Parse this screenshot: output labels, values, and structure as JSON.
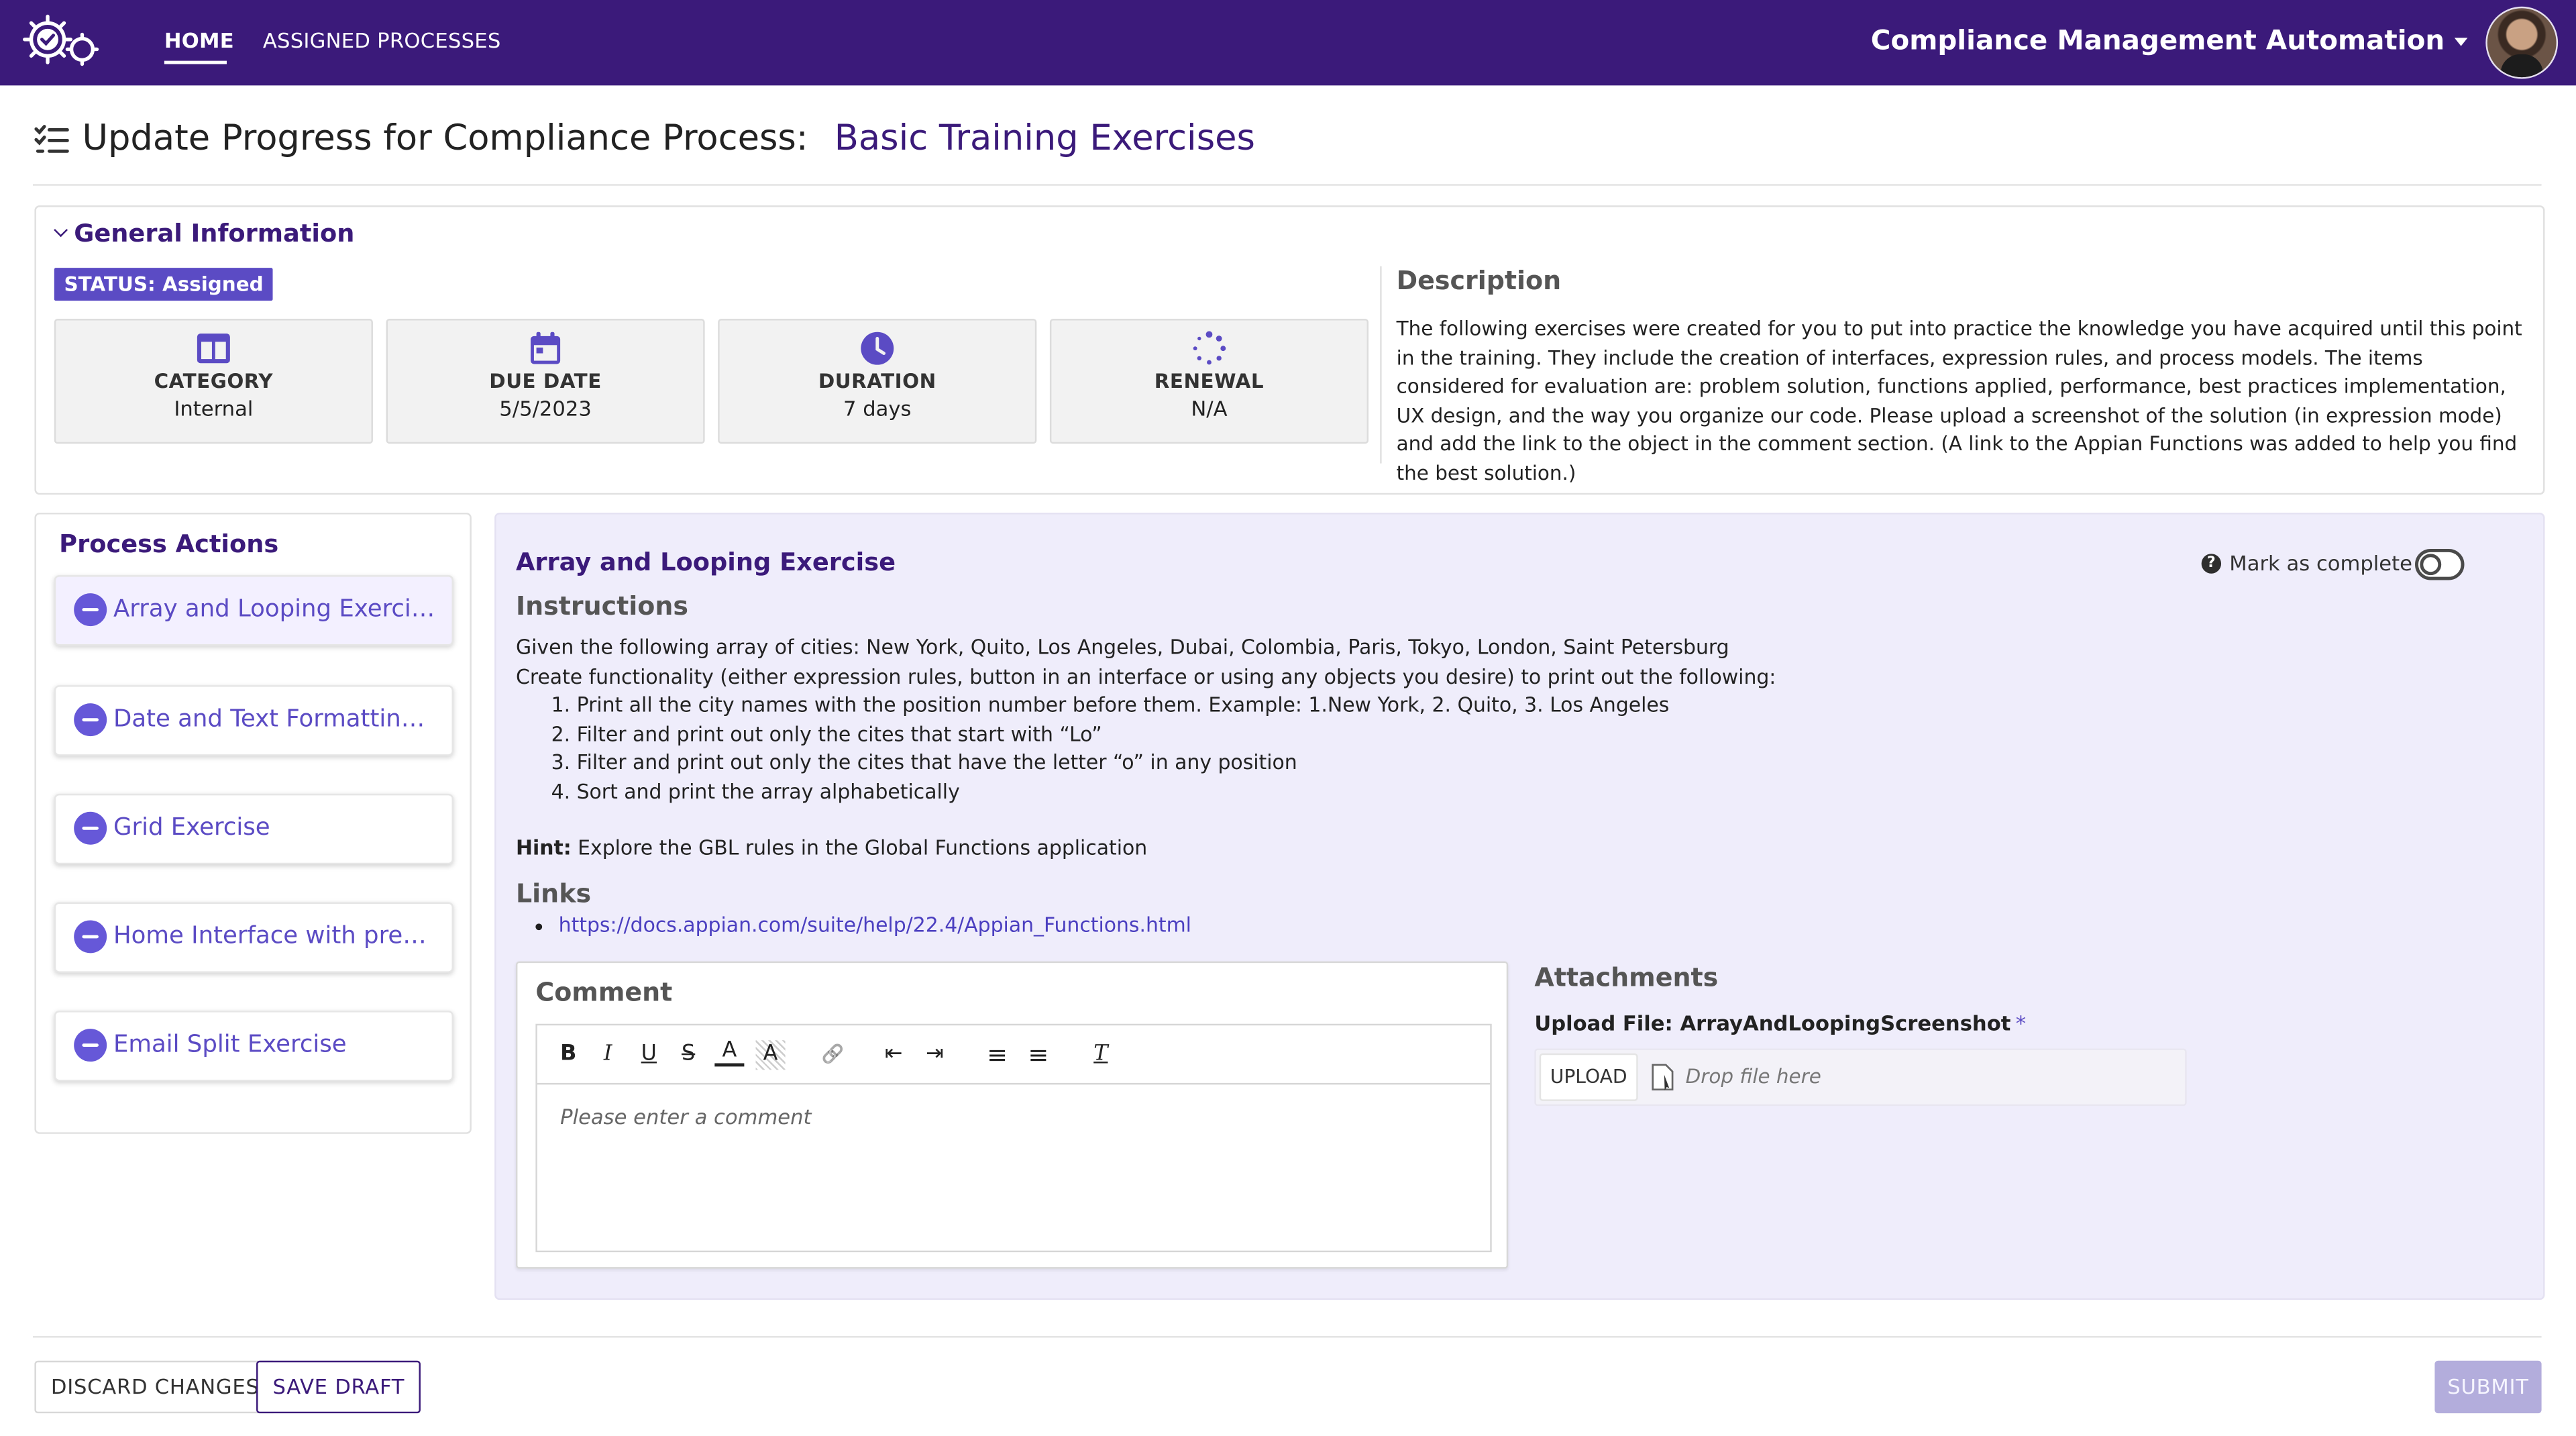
{
  "topbar": {
    "tabs": [
      {
        "label": "HOME",
        "active": true
      },
      {
        "label": "ASSIGNED PROCESSES",
        "active": false
      }
    ],
    "app_title": "Compliance Management Automation",
    "brand_color": "#3b1a7a"
  },
  "page": {
    "title": "Update Progress for Compliance Process:",
    "process_name": "Basic Training Exercises"
  },
  "general_info": {
    "heading": "General Information",
    "status": "STATUS: Assigned",
    "tiles": [
      {
        "icon": "columns-icon",
        "label": "CATEGORY",
        "value": "Internal"
      },
      {
        "icon": "calendar-icon",
        "label": "DUE DATE",
        "value": "5/5/2023"
      },
      {
        "icon": "clock-icon",
        "label": "DURATION",
        "value": "7 days"
      },
      {
        "icon": "spinner-icon",
        "label": "RENEWAL",
        "value": "N/A"
      }
    ],
    "description_title": "Description",
    "description": "The following exercises were created for you to put into practice the knowledge you have acquired until this point in the training. They include the creation of interfaces, expression rules, and process models. The items considered for evaluation are: problem solution, functions applied, performance, best practices implementation, UX design, and the way you organize our code. Please upload a screenshot of the solution (in expression mode) and add the link to the object in the comment section. (A link to the Appian Functions was added to help you find the best solution.)"
  },
  "process_actions": {
    "heading": "Process Actions",
    "items": [
      {
        "label": "Array and Looping Exercise",
        "selected": true
      },
      {
        "label": "Date and Text Formatting Exercise",
        "selected": false
      },
      {
        "label": "Grid Exercise",
        "selected": false
      },
      {
        "label": "Home Interface with previous exercises",
        "selected": false
      },
      {
        "label": "Email Split Exercise",
        "selected": false
      }
    ]
  },
  "exercise": {
    "title": "Array and Looping Exercise",
    "mark_complete_label": "Mark as complete",
    "mark_complete_on": false,
    "instructions_heading": "Instructions",
    "instructions_lines": [
      "Given the following array of cities: New York, Quito, Los Angeles, Dubai, Colombia, Paris, Tokyo, London, Saint Petersburg",
      "Create functionality (either expression rules, button in an interface or using any objects you desire) to print out the following:"
    ],
    "steps": [
      "Print all the city names with the position number before them. Example: 1.New York, 2. Quito, 3. Los Angeles",
      "Filter and print out only the cites that start with “Lo”",
      "Filter and print out only the cites that have the letter “o” in any position",
      "Sort and print the array alphabetically"
    ],
    "hint_label": "Hint:",
    "hint_text": "Explore the GBL rules in the Global Functions application",
    "links_heading": "Links",
    "links": [
      "https://docs.appian.com/suite/help/22.4/Appian_Functions.html"
    ],
    "comment": {
      "label": "Comment",
      "placeholder": "Please enter a comment",
      "toolbar": [
        {
          "name": "bold-icon",
          "glyph": "B"
        },
        {
          "name": "italic-icon",
          "glyph": "I"
        },
        {
          "name": "underline-icon",
          "glyph": "U"
        },
        {
          "name": "strikethrough-icon",
          "glyph": "S"
        },
        {
          "name": "text-color-icon",
          "glyph": "A"
        },
        {
          "name": "highlight-icon",
          "glyph": "A"
        },
        {
          "name": "link-icon",
          "glyph": "🔗"
        },
        {
          "name": "outdent-icon",
          "glyph": "⇤"
        },
        {
          "name": "indent-icon",
          "glyph": "⇥"
        },
        {
          "name": "numbered-list-icon",
          "glyph": "≡"
        },
        {
          "name": "bullet-list-icon",
          "glyph": "≡"
        },
        {
          "name": "clear-format-icon",
          "glyph": "T"
        }
      ]
    },
    "attachments": {
      "heading": "Attachments",
      "upload_label": "Upload File: ArrayAndLoopingScreenshot",
      "required_mark": "*",
      "upload_button": "UPLOAD",
      "drop_placeholder": "Drop file here"
    }
  },
  "footer": {
    "discard_label": "DISCARD CHANGES",
    "save_draft_label": "SAVE DRAFT",
    "submit_label": "SUBMIT"
  }
}
